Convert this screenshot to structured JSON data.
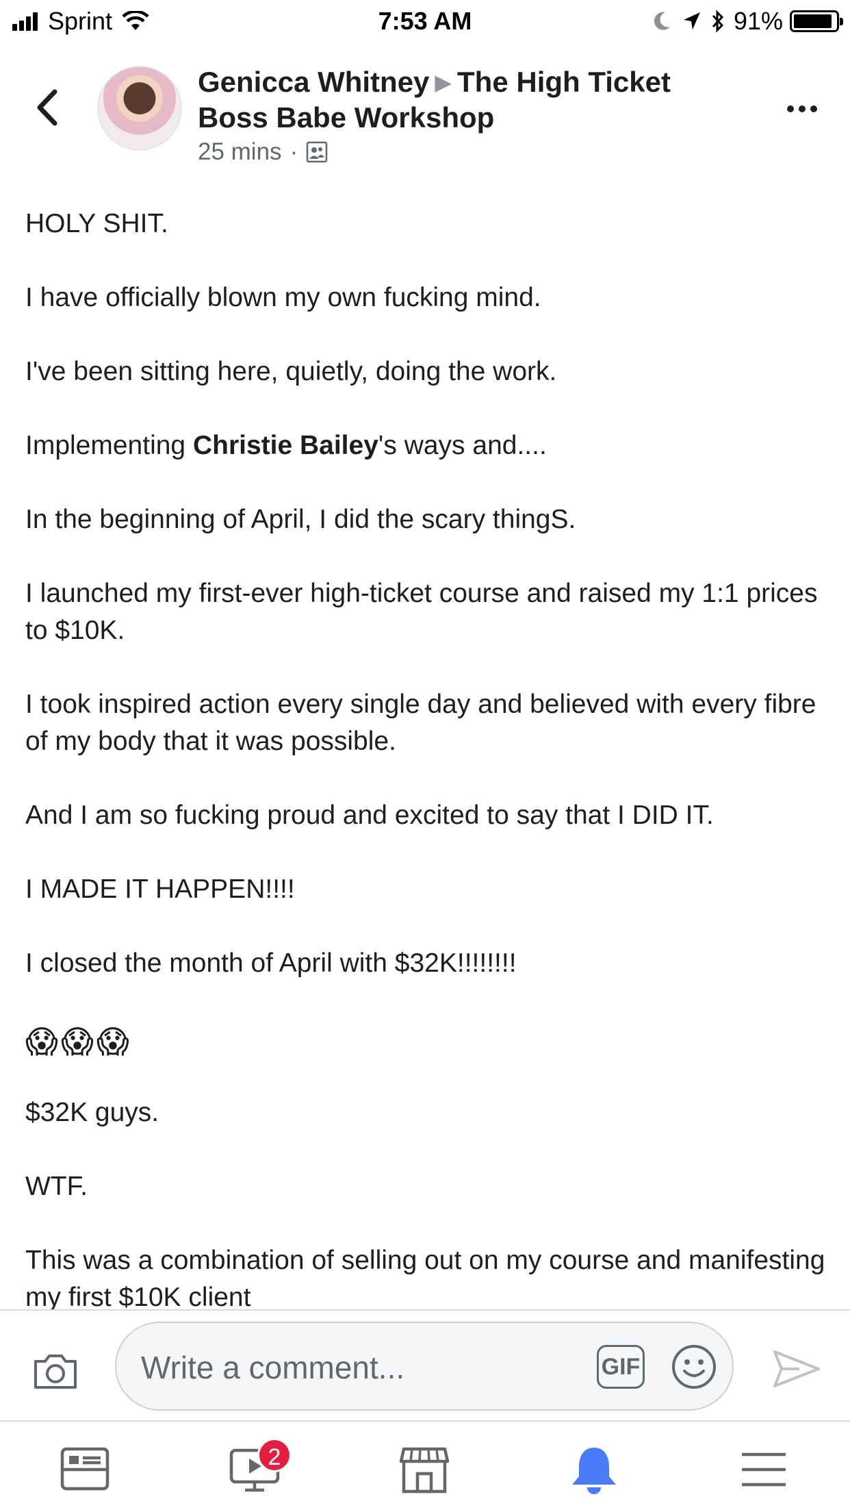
{
  "status_bar": {
    "carrier": "Sprint",
    "time": "7:53 AM",
    "battery": "91%",
    "battery_level": 0.91
  },
  "post": {
    "author": "Genicca Whitney",
    "group": "The High Ticket Boss Babe Workshop",
    "time_ago": "25 mins",
    "separator": "·",
    "audience_icon": "group-audience-icon",
    "paragraphs": {
      "p1": "HOLY SHIT.",
      "p2": "I have officially blown my own fucking mind.",
      "p3": "I've been sitting here, quietly, doing the work.",
      "p4_prefix": "Implementing ",
      "p4_mention": "Christie Bailey",
      "p4_suffix": "'s ways and....",
      "p5": "In the beginning of April,  I did the scary thingS.",
      "p6": "I launched my first-ever high-ticket course and raised my 1:1 prices to $10K.",
      "p7": "I took inspired action every single day and believed with every fibre of my body that it was possible.",
      "p8": "And I am so fucking proud and excited to say that I DID IT.",
      "p9": "I MADE IT HAPPEN!!!!",
      "p10": "I closed the month of April with $32K!!!!!!!!",
      "p11_emoji": "😱😱😱",
      "p12": "$32K guys.",
      "p13": "WTF.",
      "p14": "This was a combination of selling out on my course and manifesting my first $10K client"
    }
  },
  "comment_bar": {
    "placeholder": "Write a comment...",
    "gif_label": "GIF"
  },
  "bottom_nav": {
    "items": [
      "news-feed-icon",
      "watch-icon",
      "marketplace-icon",
      "notifications-icon",
      "menu-icon"
    ],
    "watch_badge": "2",
    "active_color": "#4a7bf7",
    "icon_color": "#65676b"
  }
}
